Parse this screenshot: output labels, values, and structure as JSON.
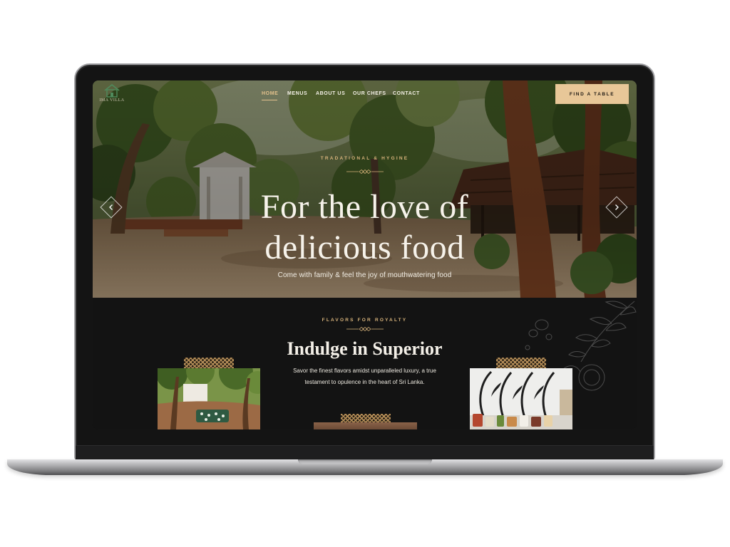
{
  "brand": {
    "logo_text": "IMA VILLA"
  },
  "nav": {
    "items": [
      {
        "label": "HOME",
        "active": true
      },
      {
        "label": "MENUS",
        "active": false
      },
      {
        "label": "ABOUT US",
        "active": false
      },
      {
        "label": "OUR CHEFS",
        "active": false
      },
      {
        "label": "CONTACT",
        "active": false
      }
    ]
  },
  "cta": {
    "label": "FIND A TABLE"
  },
  "hero": {
    "eyebrow": "TRADATIONAL & HYGINE",
    "title_line1": "For the love of",
    "title_line2": "delicious food",
    "subtitle": "Come with family & feel the joy of mouthwatering food"
  },
  "section": {
    "eyebrow": "FLAVORS FOR ROYALTY",
    "title": "Indulge in Superior",
    "description_line1": "Savor the finest flavors amidst unparalleled luxury, a true",
    "description_line2": "testament to opulence in the heart of Sri Lanka."
  },
  "icons": {
    "logo": "house-icon",
    "prev": "chevron-left-icon",
    "next": "chevron-right-icon",
    "ornament": "diamond-divider-icon"
  },
  "colors": {
    "accent": "#e8c798",
    "gold": "#d8b47c",
    "dark": "#131313",
    "logo_green": "#4f8a5c"
  }
}
